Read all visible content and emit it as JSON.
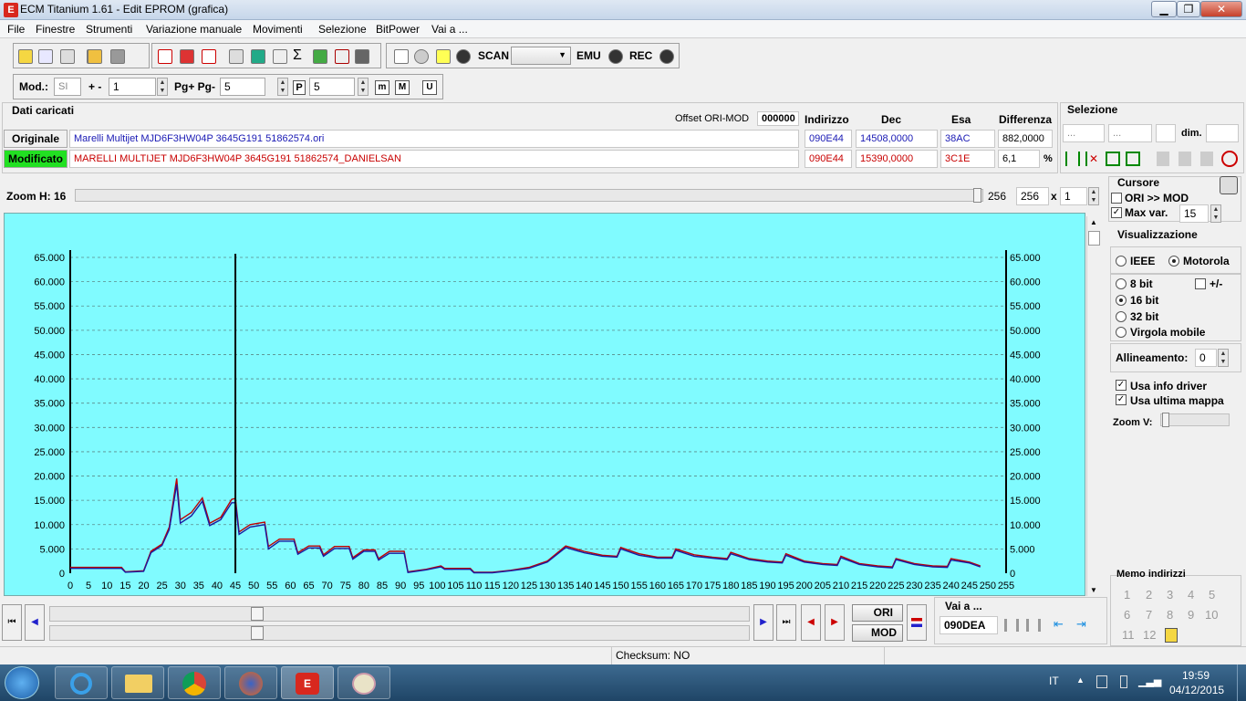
{
  "window": {
    "title": "ECM Titanium 1.61 - Edit EPROM (grafica)"
  },
  "menu": [
    "File",
    "Finestre",
    "Strumenti",
    "Variazione manuale",
    "Movimenti",
    "Selezione",
    "BitPower",
    "Vai a ..."
  ],
  "toolbar": {
    "scan_label": "SCAN",
    "emu_label": "EMU",
    "rec_label": "REC",
    "mod_label": "Mod.:",
    "mod_value": "SI",
    "plusminus_label": "+ -",
    "plusminus_value": "1",
    "pg_label": "Pg+ Pg-",
    "pg_value": "5",
    "p_label": "P",
    "p_value": "5",
    "m_label": "m",
    "M_label": "M",
    "U_label": "U"
  },
  "dati": {
    "title": "Dati caricati",
    "offset_label": "Offset ORI-MOD",
    "offset_value": "000000",
    "col_indirizzo": "Indirizzo",
    "col_dec": "Dec",
    "col_esa": "Esa",
    "col_diff": "Differenza",
    "orig_label": "Originale",
    "mod_label": "Modificato",
    "orig_file": "Marelli Multijet MJD6F3HW04P 3645G191 51862574.ori",
    "mod_file": "MARELLI MULTIJET MJD6F3HW04P 3645G191 51862574_DANIELSAN",
    "orig_addr": "090E44",
    "orig_dec": "14508,0000",
    "orig_esa": "38AC",
    "orig_diff": "882,0000",
    "mod_addr": "090E44",
    "mod_dec": "15390,0000",
    "mod_esa": "3C1E",
    "mod_diff": "6,1",
    "pct": "%"
  },
  "selezione": {
    "title": "Selezione",
    "box1": "...",
    "box2": "...",
    "dim_label": "dim."
  },
  "zoom": {
    "label": "Zoom H: 16",
    "value_text": "256",
    "field_value": "256",
    "x_label": "x",
    "mult": "1"
  },
  "cursore": {
    "title": "Cursore",
    "ori_mod": "ORI >> MOD",
    "maxvar": "Max var.",
    "maxvar_value": "15"
  },
  "visualizzazione": {
    "title": "Visualizzazione",
    "ieee": "IEEE",
    "motorola": "Motorola",
    "bit8": "8 bit",
    "plusminus": "+/-",
    "bit16": "16 bit",
    "bit32": "32 bit",
    "virgola": "Virgola mobile",
    "allineamento": "Allineamento:",
    "allineamento_value": "0",
    "usa_info": "Usa info driver",
    "usa_ultima": "Usa ultima mappa",
    "zoomv": "Zoom V:"
  },
  "memo": {
    "title": "Memo indirizzi",
    "numbers": [
      "1",
      "2",
      "3",
      "4",
      "5",
      "6",
      "7",
      "8",
      "9",
      "10",
      "11",
      "12"
    ]
  },
  "bottom": {
    "ori_btn": "ORI",
    "mod_btn": "MOD",
    "vaia_label": "Vai a ...",
    "vaia_value": "090DEA"
  },
  "status": {
    "checksum": "Checksum: NO"
  },
  "tray": {
    "lang": "IT",
    "time": "19:59",
    "date": "04/12/2015"
  },
  "chart_data": {
    "type": "line",
    "ylim": [
      0,
      65000
    ],
    "xlim": [
      0,
      255
    ],
    "y_ticks": [
      "0",
      "5.000",
      "10.000",
      "15.000",
      "20.000",
      "25.000",
      "30.000",
      "35.000",
      "40.000",
      "45.000",
      "50.000",
      "55.000",
      "60.000",
      "65.000"
    ],
    "x_ticks": [
      "0",
      "5",
      "10",
      "15",
      "20",
      "25",
      "30",
      "35",
      "40",
      "45",
      "50",
      "55",
      "60",
      "65",
      "70",
      "75",
      "80",
      "85",
      "90",
      "95",
      "100",
      "105",
      "110",
      "115",
      "120",
      "125",
      "130",
      "135",
      "140",
      "145",
      "150",
      "155",
      "160",
      "165",
      "170",
      "175",
      "180",
      "185",
      "190",
      "195",
      "200",
      "205",
      "210",
      "215",
      "220",
      "225",
      "230",
      "235",
      "240",
      "245",
      "250",
      "255"
    ],
    "cursor_x": 45,
    "grid": true,
    "series": [
      {
        "color": "#c00000",
        "points": [
          [
            0,
            1200
          ],
          [
            14,
            1200
          ],
          [
            15,
            300
          ],
          [
            20,
            500
          ],
          [
            22,
            4500
          ],
          [
            25,
            6000
          ],
          [
            27,
            9500
          ],
          [
            29,
            19500
          ],
          [
            30,
            11000
          ],
          [
            33,
            12500
          ],
          [
            36,
            15500
          ],
          [
            38,
            10300
          ],
          [
            41,
            11500
          ],
          [
            44,
            15200
          ],
          [
            45,
            15390
          ],
          [
            46,
            8500
          ],
          [
            49,
            10000
          ],
          [
            53,
            10500
          ],
          [
            54,
            5500
          ],
          [
            57,
            7000
          ],
          [
            61,
            7000
          ],
          [
            62,
            4200
          ],
          [
            65,
            5600
          ],
          [
            68,
            5600
          ],
          [
            69,
            3800
          ],
          [
            72,
            5500
          ],
          [
            76,
            5500
          ],
          [
            77,
            3200
          ],
          [
            80,
            4800
          ],
          [
            83,
            4800
          ],
          [
            84,
            3000
          ],
          [
            87,
            4500
          ],
          [
            91,
            4500
          ],
          [
            92,
            300
          ],
          [
            97,
            800
          ],
          [
            101,
            1500
          ],
          [
            102,
            1000
          ],
          [
            109,
            1000
          ],
          [
            110,
            200
          ],
          [
            115,
            200
          ],
          [
            120,
            600
          ],
          [
            125,
            1200
          ],
          [
            130,
            2500
          ],
          [
            135,
            5600
          ],
          [
            140,
            4500
          ],
          [
            145,
            3700
          ],
          [
            149,
            3500
          ],
          [
            150,
            5300
          ],
          [
            155,
            4000
          ],
          [
            160,
            3300
          ],
          [
            164,
            3300
          ],
          [
            165,
            5000
          ],
          [
            170,
            3800
          ],
          [
            175,
            3300
          ],
          [
            179,
            3000
          ],
          [
            180,
            4300
          ],
          [
            185,
            3000
          ],
          [
            190,
            2500
          ],
          [
            194,
            2300
          ],
          [
            195,
            4000
          ],
          [
            200,
            2500
          ],
          [
            205,
            2000
          ],
          [
            209,
            1800
          ],
          [
            210,
            3500
          ],
          [
            215,
            2000
          ],
          [
            220,
            1500
          ],
          [
            224,
            1300
          ],
          [
            225,
            3000
          ],
          [
            230,
            2000
          ],
          [
            235,
            1500
          ],
          [
            239,
            1400
          ],
          [
            240,
            3000
          ],
          [
            245,
            2300
          ],
          [
            248,
            1500
          ]
        ]
      },
      {
        "color": "#1a1aa0",
        "points": [
          [
            0,
            1000
          ],
          [
            14,
            1000
          ],
          [
            15,
            200
          ],
          [
            20,
            400
          ],
          [
            22,
            4200
          ],
          [
            25,
            5700
          ],
          [
            27,
            9000
          ],
          [
            29,
            18300
          ],
          [
            30,
            10300
          ],
          [
            33,
            11800
          ],
          [
            36,
            14800
          ],
          [
            38,
            9800
          ],
          [
            41,
            11000
          ],
          [
            44,
            14500
          ],
          [
            45,
            14508
          ],
          [
            46,
            8000
          ],
          [
            49,
            9500
          ],
          [
            53,
            10000
          ],
          [
            54,
            5000
          ],
          [
            57,
            6600
          ],
          [
            61,
            6600
          ],
          [
            62,
            3900
          ],
          [
            65,
            5200
          ],
          [
            68,
            5200
          ],
          [
            69,
            3500
          ],
          [
            72,
            5100
          ],
          [
            76,
            5100
          ],
          [
            77,
            2900
          ],
          [
            80,
            4500
          ],
          [
            83,
            4500
          ],
          [
            84,
            2700
          ],
          [
            87,
            4100
          ],
          [
            91,
            4100
          ],
          [
            92,
            150
          ],
          [
            97,
            700
          ],
          [
            101,
            1300
          ],
          [
            102,
            800
          ],
          [
            109,
            800
          ],
          [
            110,
            100
          ],
          [
            115,
            100
          ],
          [
            120,
            500
          ],
          [
            125,
            1000
          ],
          [
            130,
            2300
          ],
          [
            135,
            5300
          ],
          [
            140,
            4200
          ],
          [
            145,
            3500
          ],
          [
            149,
            3300
          ],
          [
            150,
            5000
          ],
          [
            155,
            3700
          ],
          [
            160,
            3100
          ],
          [
            164,
            3100
          ],
          [
            165,
            4700
          ],
          [
            170,
            3500
          ],
          [
            175,
            3100
          ],
          [
            179,
            2800
          ],
          [
            180,
            4000
          ],
          [
            185,
            2800
          ],
          [
            190,
            2300
          ],
          [
            194,
            2100
          ],
          [
            195,
            3700
          ],
          [
            200,
            2300
          ],
          [
            205,
            1800
          ],
          [
            209,
            1600
          ],
          [
            210,
            3200
          ],
          [
            215,
            1800
          ],
          [
            220,
            1300
          ],
          [
            224,
            1100
          ],
          [
            225,
            2800
          ],
          [
            230,
            1800
          ],
          [
            235,
            1300
          ],
          [
            239,
            1200
          ],
          [
            240,
            2700
          ],
          [
            245,
            2100
          ],
          [
            248,
            1300
          ]
        ]
      }
    ]
  }
}
